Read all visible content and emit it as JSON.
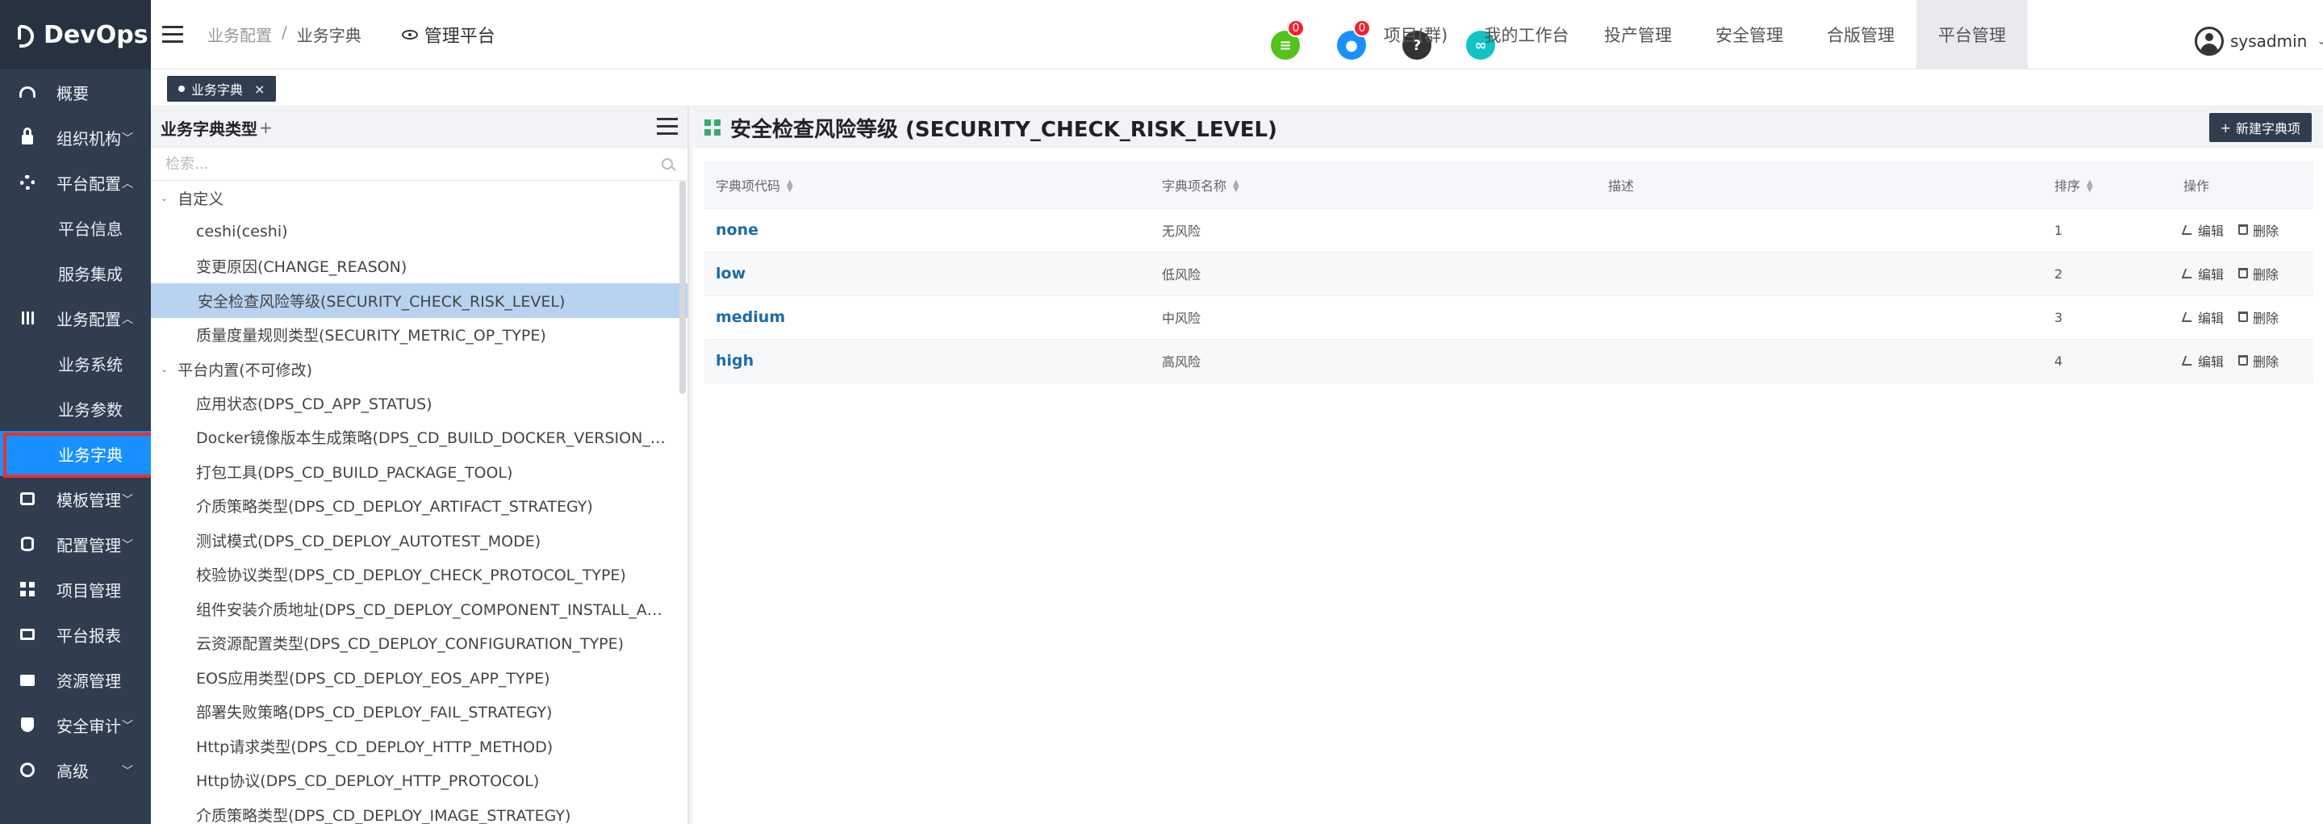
{
  "brand": {
    "name": "DevOps"
  },
  "sidebar": {
    "items": [
      {
        "label": "概要",
        "icon": "dashboard-icon"
      },
      {
        "label": "组织机构",
        "icon": "lock-icon",
        "chevron": "down"
      },
      {
        "label": "平台配置",
        "icon": "gear-icon",
        "chevron": "up"
      },
      {
        "label": "平台信息",
        "sub": true
      },
      {
        "label": "服务集成",
        "sub": true
      },
      {
        "label": "业务配置",
        "icon": "sliders-icon",
        "chevron": "up"
      },
      {
        "label": "业务系统",
        "sub": true
      },
      {
        "label": "业务参数",
        "sub": true
      },
      {
        "label": "业务字典",
        "sub": true,
        "active": true
      },
      {
        "label": "模板管理",
        "icon": "template-icon",
        "chevron": "down"
      },
      {
        "label": "配置管理",
        "icon": "database-icon",
        "chevron": "down"
      },
      {
        "label": "项目管理",
        "icon": "grid-icon"
      },
      {
        "label": "平台报表",
        "icon": "monitor-icon"
      },
      {
        "label": "资源管理",
        "icon": "folder-icon"
      },
      {
        "label": "安全审计",
        "icon": "shield-icon",
        "chevron": "down"
      },
      {
        "label": "高级",
        "icon": "advanced-icon",
        "chevron": "down"
      }
    ]
  },
  "header": {
    "breadcrumb": [
      "业务配置",
      "/",
      "业务字典"
    ],
    "platform_label": "管理平台",
    "icons": [
      {
        "name": "todo-icon",
        "color": "#52c41a",
        "badge": "0",
        "glyph": "≡"
      },
      {
        "name": "bell-icon",
        "color": "#1890ff",
        "badge": "0",
        "glyph": "●"
      },
      {
        "name": "help-icon",
        "color": "#333333",
        "glyph": "?"
      },
      {
        "name": "link-icon",
        "color": "#13c2c2",
        "glyph": "∞"
      }
    ],
    "nav": [
      "项目(群)",
      "我的工作台",
      "投产管理",
      "安全管理",
      "合版管理",
      "平台管理"
    ],
    "active_nav": "平台管理",
    "user": "sysadmin"
  },
  "tabs": [
    {
      "label": "业务字典",
      "close": "×"
    }
  ],
  "tree": {
    "title": "业务字典类型",
    "add_label": "+",
    "search_placeholder": "检索...",
    "groups": [
      {
        "label": "自定义",
        "items": [
          "ceshi(ceshi)",
          "变更原因(CHANGE_REASON)",
          "安全检查风险等级(SECURITY_CHECK_RISK_LEVEL)",
          "质量度量规则类型(SECURITY_METRIC_OP_TYPE)"
        ]
      },
      {
        "label": "平台内置(不可修改)",
        "items": [
          "应用状态(DPS_CD_APP_STATUS)",
          "Docker镜像版本生成策略(DPS_CD_BUILD_DOCKER_VERSION_…",
          "打包工具(DPS_CD_BUILD_PACKAGE_TOOL)",
          "介质策略类型(DPS_CD_DEPLOY_ARTIFACT_STRATEGY)",
          "测试模式(DPS_CD_DEPLOY_AUTOTEST_MODE)",
          "校验协议类型(DPS_CD_DEPLOY_CHECK_PROTOCOL_TYPE)",
          "组件安装介质地址(DPS_CD_DEPLOY_COMPONENT_INSTALL_A…",
          "云资源配置类型(DPS_CD_DEPLOY_CONFIGURATION_TYPE)",
          "EOS应用类型(DPS_CD_DEPLOY_EOS_APP_TYPE)",
          "部署失败策略(DPS_CD_DEPLOY_FAIL_STRATEGY)",
          "Http请求类型(DPS_CD_DEPLOY_HTTP_METHOD)",
          "Http协议(DPS_CD_DEPLOY_HTTP_PROTOCOL)",
          "介质策略类型(DPS_CD_DEPLOY_IMAGE_STRATEGY)"
        ]
      }
    ],
    "selected": "安全检查风险等级(SECURITY_CHECK_RISK_LEVEL)"
  },
  "main": {
    "title": "安全检查风险等级 (SECURITY_CHECK_RISK_LEVEL)",
    "new_button": "新建字典项",
    "new_button_icon": "+",
    "columns": [
      "字典项代码",
      "字典项名称",
      "描述",
      "排序",
      "操作"
    ],
    "rows": [
      {
        "code": "none",
        "name": "无风险",
        "desc": "",
        "order": "1"
      },
      {
        "code": "low",
        "name": "低风险",
        "desc": "",
        "order": "2"
      },
      {
        "code": "medium",
        "name": "中风险",
        "desc": "",
        "order": "3"
      },
      {
        "code": "high",
        "name": "高风险",
        "desc": "",
        "order": "4"
      }
    ],
    "actions": {
      "edit": "编辑",
      "delete": "删除"
    }
  }
}
